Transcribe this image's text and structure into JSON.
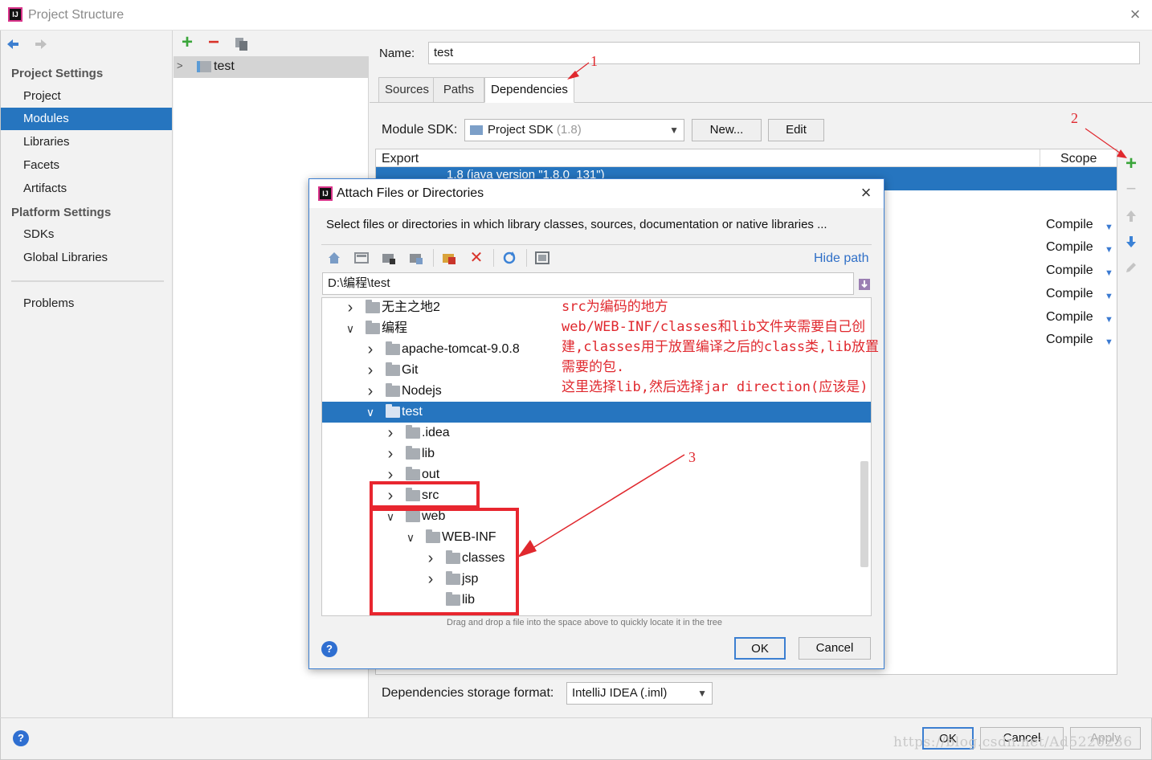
{
  "window": {
    "title": "Project Structure",
    "close_icon": "×"
  },
  "nav": {
    "back_icon": "arrow-left-icon",
    "forward_icon": "arrow-right-icon",
    "project_settings_header": "Project Settings",
    "project_settings_items": [
      {
        "label": "Project",
        "selected": false
      },
      {
        "label": "Modules",
        "selected": true
      },
      {
        "label": "Libraries",
        "selected": false
      },
      {
        "label": "Facets",
        "selected": false
      },
      {
        "label": "Artifacts",
        "selected": false
      }
    ],
    "platform_settings_header": "Platform Settings",
    "platform_settings_items": [
      {
        "label": "SDKs"
      },
      {
        "label": "Global Libraries"
      }
    ],
    "problems_label": "Problems"
  },
  "modules": {
    "toolbar": {
      "add": "+",
      "remove": "−",
      "copy": "copy-icon"
    },
    "tree_item": "test"
  },
  "module_settings": {
    "name_label": "Name:",
    "name_value": "test",
    "tabs": [
      "Sources",
      "Paths",
      "Dependencies"
    ],
    "active_tab": "Dependencies",
    "sdk_label": "Module SDK:",
    "sdk_value": "Project SDK",
    "sdk_version": "(1.8)",
    "new_button": "New...",
    "edit_button": "Edit",
    "table": {
      "col_export": "Export",
      "col_scope": "Scope",
      "selected_row_partial": "1.8 (java version \"1.8.0_131\")",
      "scopes": [
        "Compile",
        "Compile",
        "Compile",
        "Compile",
        "Compile",
        "Compile"
      ]
    },
    "storage_format_label": "Dependencies storage format:",
    "storage_format_value": "IntelliJ IDEA (.iml)"
  },
  "footer": {
    "ok": "OK",
    "cancel": "Cancel",
    "apply": "Apply",
    "help": "?"
  },
  "dialog": {
    "title": "Attach Files or Directories",
    "close_icon": "×",
    "description": "Select files or directories in which library classes, sources, documentation or native libraries ...",
    "hide_path": "Hide path",
    "path_value": "D:\\编程\\test",
    "tree": [
      {
        "label": "无主之地2",
        "depth": 0,
        "expanded": false,
        "has_children": true,
        "selected": false
      },
      {
        "label": "编程",
        "depth": 0,
        "expanded": true,
        "has_children": true,
        "selected": false
      },
      {
        "label": "apache-tomcat-9.0.8",
        "depth": 1,
        "expanded": false,
        "has_children": true,
        "selected": false
      },
      {
        "label": "Git",
        "depth": 1,
        "expanded": false,
        "has_children": true,
        "selected": false
      },
      {
        "label": "Nodejs",
        "depth": 1,
        "expanded": false,
        "has_children": true,
        "selected": false
      },
      {
        "label": "test",
        "depth": 1,
        "expanded": true,
        "has_children": true,
        "selected": true
      },
      {
        "label": ".idea",
        "depth": 2,
        "expanded": false,
        "has_children": true,
        "selected": false
      },
      {
        "label": "lib",
        "depth": 2,
        "expanded": false,
        "has_children": true,
        "selected": false
      },
      {
        "label": "out",
        "depth": 2,
        "expanded": false,
        "has_children": true,
        "selected": false
      },
      {
        "label": "src",
        "depth": 2,
        "expanded": false,
        "has_children": true,
        "selected": false
      },
      {
        "label": "web",
        "depth": 2,
        "expanded": true,
        "has_children": true,
        "selected": false
      },
      {
        "label": "WEB-INF",
        "depth": 3,
        "expanded": true,
        "has_children": true,
        "selected": false
      },
      {
        "label": "classes",
        "depth": 4,
        "expanded": false,
        "has_children": true,
        "selected": false
      },
      {
        "label": "jsp",
        "depth": 4,
        "expanded": false,
        "has_children": true,
        "selected": false
      },
      {
        "label": "lib",
        "depth": 4,
        "expanded": false,
        "has_children": false,
        "selected": false
      }
    ],
    "drag_hint": "Drag and drop a file into the space above to quickly locate it in the tree",
    "ok": "OK",
    "cancel": "Cancel",
    "help": "?"
  },
  "annotations": {
    "num1": "1",
    "num2": "2",
    "num3": "3",
    "note_lines": [
      "src为编码的地方",
      "web/WEB-INF/classes和lib文件夹需要自己创",
      "建,classes用于放置编译之后的class类,lib放置",
      "需要的包.",
      "这里选择lib,然后选择jar direction(应该是)"
    ],
    "color": "#e0282e"
  },
  "watermark": "https://blog.csdn.net/Ad5220236",
  "colors": {
    "selection": "#2675bf",
    "accent_blue": "#2f6fc7",
    "add_green": "#3aa53a",
    "remove_red": "#d9342b"
  }
}
